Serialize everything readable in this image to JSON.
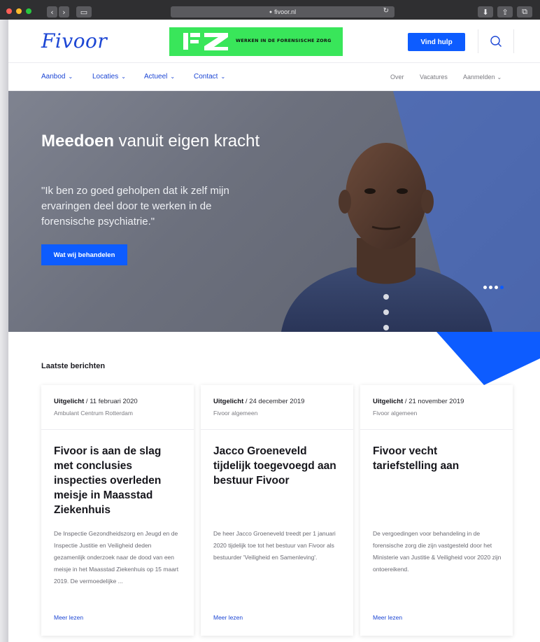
{
  "browser": {
    "url": "fivoor.nl",
    "back_glyph": "‹",
    "forward_glyph": "›",
    "sidebar_glyph": "▭",
    "reload_glyph": "↻",
    "download_glyph": "⬇",
    "share_glyph": "⇪",
    "tabs_glyph": "⧉"
  },
  "header": {
    "logo": "Fivoor",
    "banner_text": "WERKEN IN DE FORENSISCHE ZORG",
    "help_button": "Vind hulp"
  },
  "nav": {
    "left": [
      "Aanbod",
      "Locaties",
      "Actueel",
      "Contact"
    ],
    "chevron": "⌄",
    "right": [
      "Over",
      "Vacatures",
      "Aanmelden"
    ]
  },
  "hero": {
    "title_bold": "Meedoen",
    "title_rest": " vanuit eigen kracht",
    "quote": "\"Ik ben zo goed geholpen dat ik zelf mijn ervaringen deel door te werken in de forensische psychiatrie.\"",
    "button": "Wat wij behandelen",
    "carousel_total": 4,
    "carousel_active": 4
  },
  "latest": {
    "title": "Laatste berichten",
    "cards": [
      {
        "tag": "Uitgelicht",
        "date": " / 11 februari 2020",
        "category": "Ambulant Centrum Rotterdam",
        "title": "Fivoor is aan de slag met conclusies inspecties overleden meisje in Maasstad Ziekenhuis",
        "body": "De Inspectie Gezondheidszorg en Jeugd en de Inspectie Justitie en Veiligheid deden gezamenlijk onderzoek naar de dood van een meisje in het Maasstad Ziekenhuis op 15 maart 2019. De vermoedelijke ...",
        "link": "Meer lezen"
      },
      {
        "tag": "Uitgelicht",
        "date": " / 24 december 2019",
        "category": "Fivoor algemeen",
        "title": "Jacco Groeneveld tijdelijk toegevoegd aan bestuur Fivoor",
        "body": "De heer Jacco Groeneveld treedt per 1 januari 2020 tijdelijk toe tot het bestuur van Fivoor als bestuurder 'Veiligheid en Samenleving'.",
        "link": "Meer lezen"
      },
      {
        "tag": "Uitgelicht",
        "date": " / 21 november 2019",
        "category": "Fivoor algemeen",
        "title": "Fivoor vecht tariefstelling aan",
        "body": "De vergoedingen voor behandeling in de forensische zorg die zijn vastgesteld door het Ministerie van Justitie & Veiligheid voor 2020 zijn ontoereikend.",
        "link": "Meer lezen"
      }
    ]
  },
  "colors": {
    "brand_blue": "#0d5cff",
    "logo_blue": "#1c46d4",
    "banner_green": "#39e65a"
  }
}
